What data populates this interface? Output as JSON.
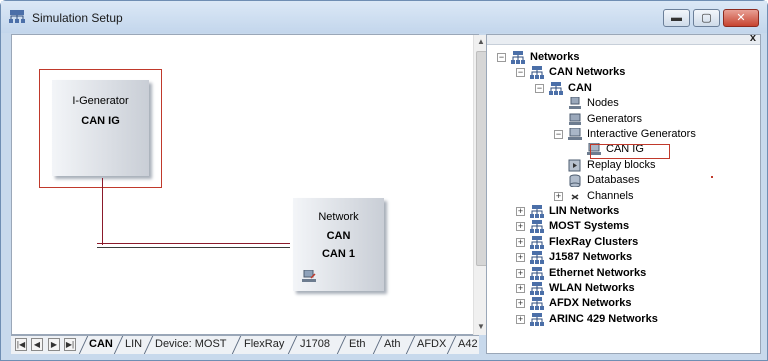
{
  "window": {
    "title": "Simulation Setup",
    "minimize_label": "▬",
    "maximize_label": "▢",
    "close_label": "✕"
  },
  "diagram": {
    "generator_block": {
      "type": "I-Generator",
      "name": "CAN IG"
    },
    "network_block": {
      "type": "Network",
      "protocol": "CAN",
      "name": "CAN 1"
    }
  },
  "tabs": {
    "nav_buttons": [
      "|◀",
      "◀",
      "▶",
      "▶|"
    ],
    "items": [
      "CAN",
      "LIN",
      "Device: MOST",
      "FlexRay",
      "J1708",
      "Eth",
      "Ath",
      "AFDX",
      "A42"
    ],
    "active": "CAN"
  },
  "tree": {
    "close_label": "x",
    "rows": [
      {
        "label": "Networks",
        "bold": true,
        "expander": "−",
        "icon": "network-icon"
      },
      {
        "label": "CAN Networks",
        "bold": true,
        "expander": "−",
        "icon": "network-icon"
      },
      {
        "label": "CAN",
        "bold": true,
        "expander": "−",
        "icon": "network-icon"
      },
      {
        "label": "Nodes",
        "bold": false,
        "expander": "",
        "icon": "node-icon"
      },
      {
        "label": "Generators",
        "bold": false,
        "expander": "",
        "icon": "generator-icon"
      },
      {
        "label": "Interactive Generators",
        "bold": false,
        "expander": "−",
        "icon": "interactive-generator-icon"
      },
      {
        "label": "CAN IG",
        "bold": false,
        "expander": "",
        "icon": "interactive-generator-icon",
        "selected": true
      },
      {
        "label": "Replay blocks",
        "bold": false,
        "expander": "",
        "icon": "replay-icon"
      },
      {
        "label": "Databases",
        "bold": false,
        "expander": "",
        "icon": "database-icon"
      },
      {
        "label": "Channels",
        "bold": false,
        "expander": "+",
        "icon": "channel-icon"
      },
      {
        "label": "LIN Networks",
        "bold": true,
        "expander": "+",
        "icon": "network-icon"
      },
      {
        "label": "MOST Systems",
        "bold": true,
        "expander": "+",
        "icon": "network-icon"
      },
      {
        "label": "FlexRay Clusters",
        "bold": true,
        "expander": "+",
        "icon": "network-icon"
      },
      {
        "label": "J1587 Networks",
        "bold": true,
        "expander": "+",
        "icon": "network-icon"
      },
      {
        "label": "Ethernet Networks",
        "bold": true,
        "expander": "+",
        "icon": "network-icon"
      },
      {
        "label": "WLAN Networks",
        "bold": true,
        "expander": "+",
        "icon": "network-icon"
      },
      {
        "label": "AFDX Networks",
        "bold": true,
        "expander": "+",
        "icon": "network-icon"
      },
      {
        "label": "ARINC 429 Networks",
        "bold": true,
        "expander": "+",
        "icon": "network-icon"
      }
    ]
  },
  "colors": {
    "selection_outline": "#c0392b",
    "wire": "#8b1a2b",
    "window_frame": "#c8d9ec"
  }
}
